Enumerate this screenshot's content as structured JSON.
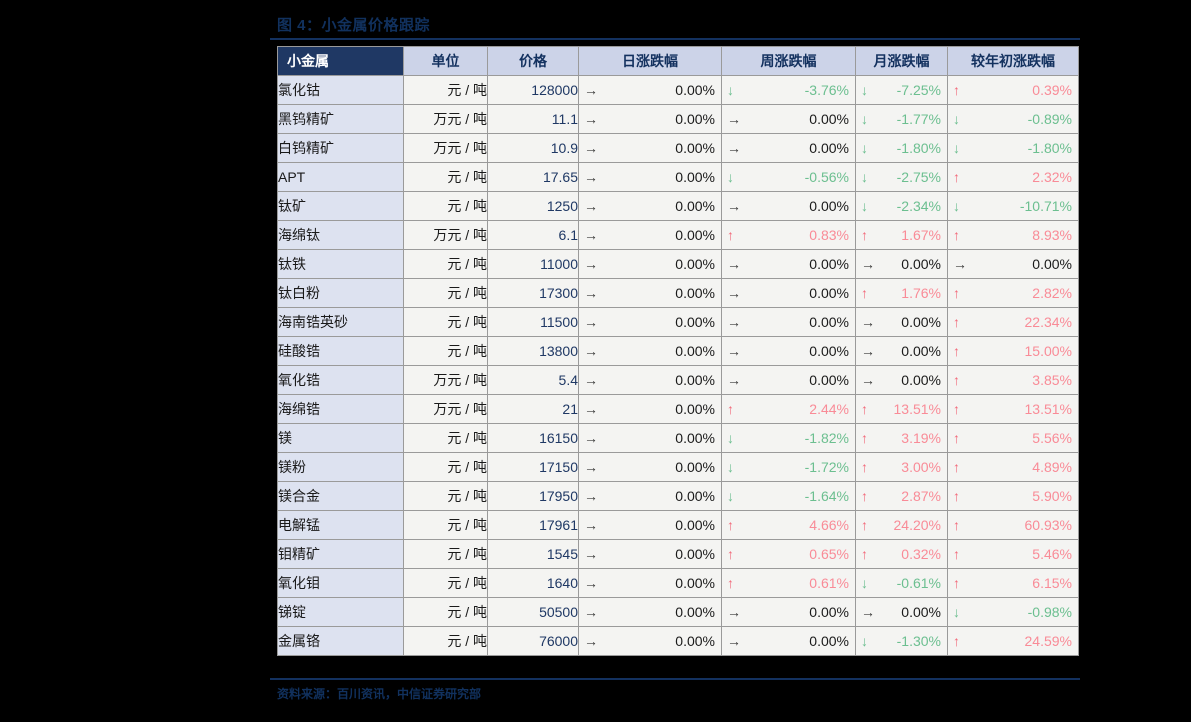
{
  "figure": {
    "title": "图 4：小金属价格跟踪",
    "source": "资料来源：百川资讯，中信证券研究部"
  },
  "colors": {
    "header_bg": "#1f3864",
    "header_alt_bg": "#ccd3e8",
    "name_cell_bg": "#dde2f0",
    "up": "#f98b97",
    "down": "#6cbf90",
    "flat": "#1a1a1a",
    "title": "#11315e",
    "page_bg": "#000000"
  },
  "table": {
    "headers": [
      "小金属",
      "单位",
      "价格",
      "日涨跌幅",
      "周涨跌幅",
      "月涨跌幅",
      "较年初涨跌幅"
    ],
    "icons": {
      "up": "up-arrow-icon",
      "down": "down-arrow-icon",
      "flat": "right-arrow-icon"
    },
    "glyphs": {
      "up": "↑",
      "down": "↓",
      "flat": "→"
    },
    "rows": [
      {
        "name": "氯化钴",
        "unit": "元 / 吨",
        "price": "128000",
        "daily": {
          "dir": "flat",
          "value": "0.00%"
        },
        "weekly": {
          "dir": "down",
          "value": "-3.76%"
        },
        "monthly": {
          "dir": "down",
          "value": "-7.25%"
        },
        "ytd": {
          "dir": "up",
          "value": "0.39%"
        }
      },
      {
        "name": "黑钨精矿",
        "unit": "万元 / 吨",
        "price": "11.1",
        "daily": {
          "dir": "flat",
          "value": "0.00%"
        },
        "weekly": {
          "dir": "flat",
          "value": "0.00%"
        },
        "monthly": {
          "dir": "down",
          "value": "-1.77%"
        },
        "ytd": {
          "dir": "down",
          "value": "-0.89%"
        }
      },
      {
        "name": "白钨精矿",
        "unit": "万元 / 吨",
        "price": "10.9",
        "daily": {
          "dir": "flat",
          "value": "0.00%"
        },
        "weekly": {
          "dir": "flat",
          "value": "0.00%"
        },
        "monthly": {
          "dir": "down",
          "value": "-1.80%"
        },
        "ytd": {
          "dir": "down",
          "value": "-1.80%"
        }
      },
      {
        "name": "APT",
        "unit": "元 / 吨",
        "price": "17.65",
        "daily": {
          "dir": "flat",
          "value": "0.00%"
        },
        "weekly": {
          "dir": "down",
          "value": "-0.56%"
        },
        "monthly": {
          "dir": "down",
          "value": "-2.75%"
        },
        "ytd": {
          "dir": "up",
          "value": "2.32%"
        }
      },
      {
        "name": "钛矿",
        "unit": "元 / 吨",
        "price": "1250",
        "daily": {
          "dir": "flat",
          "value": "0.00%"
        },
        "weekly": {
          "dir": "flat",
          "value": "0.00%"
        },
        "monthly": {
          "dir": "down",
          "value": "-2.34%"
        },
        "ytd": {
          "dir": "down",
          "value": "-10.71%"
        }
      },
      {
        "name": "海绵钛",
        "unit": "万元 / 吨",
        "price": "6.1",
        "daily": {
          "dir": "flat",
          "value": "0.00%"
        },
        "weekly": {
          "dir": "up",
          "value": "0.83%"
        },
        "monthly": {
          "dir": "up",
          "value": "1.67%"
        },
        "ytd": {
          "dir": "up",
          "value": "8.93%"
        }
      },
      {
        "name": "钛铁",
        "unit": "元 / 吨",
        "price": "11000",
        "daily": {
          "dir": "flat",
          "value": "0.00%"
        },
        "weekly": {
          "dir": "flat",
          "value": "0.00%"
        },
        "monthly": {
          "dir": "flat",
          "value": "0.00%"
        },
        "ytd": {
          "dir": "flat",
          "value": "0.00%"
        }
      },
      {
        "name": "钛白粉",
        "unit": "元 / 吨",
        "price": "17300",
        "daily": {
          "dir": "flat",
          "value": "0.00%"
        },
        "weekly": {
          "dir": "flat",
          "value": "0.00%"
        },
        "monthly": {
          "dir": "up",
          "value": "1.76%"
        },
        "ytd": {
          "dir": "up",
          "value": "2.82%"
        }
      },
      {
        "name": "海南锆英砂",
        "unit": "元 / 吨",
        "price": "11500",
        "daily": {
          "dir": "flat",
          "value": "0.00%"
        },
        "weekly": {
          "dir": "flat",
          "value": "0.00%"
        },
        "monthly": {
          "dir": "flat",
          "value": "0.00%"
        },
        "ytd": {
          "dir": "up",
          "value": "22.34%"
        }
      },
      {
        "name": "硅酸锆",
        "unit": "元 / 吨",
        "price": "13800",
        "daily": {
          "dir": "flat",
          "value": "0.00%"
        },
        "weekly": {
          "dir": "flat",
          "value": "0.00%"
        },
        "monthly": {
          "dir": "flat",
          "value": "0.00%"
        },
        "ytd": {
          "dir": "up",
          "value": "15.00%"
        }
      },
      {
        "name": "氧化锆",
        "unit": "万元 / 吨",
        "price": "5.4",
        "daily": {
          "dir": "flat",
          "value": "0.00%"
        },
        "weekly": {
          "dir": "flat",
          "value": "0.00%"
        },
        "monthly": {
          "dir": "flat",
          "value": "0.00%"
        },
        "ytd": {
          "dir": "up",
          "value": "3.85%"
        }
      },
      {
        "name": "海绵锆",
        "unit": "万元 / 吨",
        "price": "21",
        "daily": {
          "dir": "flat",
          "value": "0.00%"
        },
        "weekly": {
          "dir": "up",
          "value": "2.44%"
        },
        "monthly": {
          "dir": "up",
          "value": "13.51%"
        },
        "ytd": {
          "dir": "up",
          "value": "13.51%"
        }
      },
      {
        "name": "镁",
        "unit": "元 / 吨",
        "price": "16150",
        "daily": {
          "dir": "flat",
          "value": "0.00%"
        },
        "weekly": {
          "dir": "down",
          "value": "-1.82%"
        },
        "monthly": {
          "dir": "up",
          "value": "3.19%"
        },
        "ytd": {
          "dir": "up",
          "value": "5.56%"
        }
      },
      {
        "name": "镁粉",
        "unit": "元 / 吨",
        "price": "17150",
        "daily": {
          "dir": "flat",
          "value": "0.00%"
        },
        "weekly": {
          "dir": "down",
          "value": "-1.72%"
        },
        "monthly": {
          "dir": "up",
          "value": "3.00%"
        },
        "ytd": {
          "dir": "up",
          "value": "4.89%"
        }
      },
      {
        "name": "镁合金",
        "unit": "元 / 吨",
        "price": "17950",
        "daily": {
          "dir": "flat",
          "value": "0.00%"
        },
        "weekly": {
          "dir": "down",
          "value": "-1.64%"
        },
        "monthly": {
          "dir": "up",
          "value": "2.87%"
        },
        "ytd": {
          "dir": "up",
          "value": "5.90%"
        }
      },
      {
        "name": "电解锰",
        "unit": "元 / 吨",
        "price": "17961",
        "daily": {
          "dir": "flat",
          "value": "0.00%"
        },
        "weekly": {
          "dir": "up",
          "value": "4.66%"
        },
        "monthly": {
          "dir": "up",
          "value": "24.20%"
        },
        "ytd": {
          "dir": "up",
          "value": "60.93%"
        }
      },
      {
        "name": "钼精矿",
        "unit": "元 / 吨",
        "price": "1545",
        "daily": {
          "dir": "flat",
          "value": "0.00%"
        },
        "weekly": {
          "dir": "up",
          "value": "0.65%"
        },
        "monthly": {
          "dir": "up",
          "value": "0.32%"
        },
        "ytd": {
          "dir": "up",
          "value": "5.46%"
        }
      },
      {
        "name": "氧化钼",
        "unit": "元 / 吨",
        "price": "1640",
        "daily": {
          "dir": "flat",
          "value": "0.00%"
        },
        "weekly": {
          "dir": "up",
          "value": "0.61%"
        },
        "monthly": {
          "dir": "down",
          "value": "-0.61%"
        },
        "ytd": {
          "dir": "up",
          "value": "6.15%"
        }
      },
      {
        "name": "锑锭",
        "unit": "元 / 吨",
        "price": "50500",
        "daily": {
          "dir": "flat",
          "value": "0.00%"
        },
        "weekly": {
          "dir": "flat",
          "value": "0.00%"
        },
        "monthly": {
          "dir": "flat",
          "value": "0.00%"
        },
        "ytd": {
          "dir": "down",
          "value": "-0.98%"
        }
      },
      {
        "name": "金属铬",
        "unit": "元 / 吨",
        "price": "76000",
        "daily": {
          "dir": "flat",
          "value": "0.00%"
        },
        "weekly": {
          "dir": "flat",
          "value": "0.00%"
        },
        "monthly": {
          "dir": "down",
          "value": "-1.30%"
        },
        "ytd": {
          "dir": "up",
          "value": "24.59%"
        }
      }
    ]
  }
}
